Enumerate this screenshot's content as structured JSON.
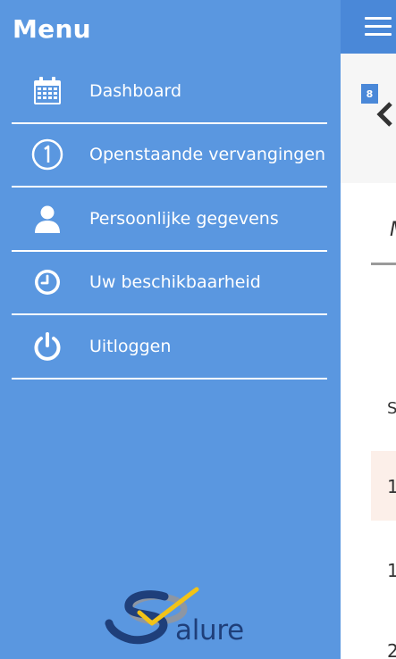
{
  "menu": {
    "title": "Menu",
    "items": [
      {
        "label": "Dashboard",
        "icon": "calendar-icon"
      },
      {
        "label": "Openstaande vervangingen",
        "icon": "number-one-circle-icon"
      },
      {
        "label": "Persoonlijke gegevens",
        "icon": "user-icon"
      },
      {
        "label": "Uw beschikbaarheid",
        "icon": "clock-icon"
      },
      {
        "label": "Uitloggen",
        "icon": "power-icon"
      }
    ],
    "logo_text": "alure"
  },
  "main": {
    "badge": "8",
    "column_header_partial": "M",
    "cells": [
      "S",
      "1",
      "1",
      "2"
    ]
  },
  "colors": {
    "menu_background": "#5a97e0",
    "topbar_background": "#4a88d8",
    "logo_blue": "#1f3f7a",
    "logo_yellow": "#f2c318"
  }
}
